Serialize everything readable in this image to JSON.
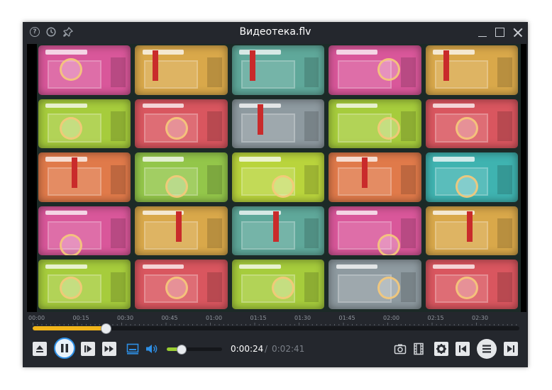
{
  "window": {
    "title": "Видеотека.flv"
  },
  "titlebar_icons": [
    "help-icon",
    "history-icon",
    "pin-icon"
  ],
  "timeline": {
    "labels": [
      "00:00",
      "00:15",
      "00:30",
      "00:45",
      "01:00",
      "01:15",
      "01:30",
      "01:45",
      "02:00",
      "02:15",
      "02:30"
    ],
    "progress": 0.15
  },
  "volume": {
    "level": 0.26
  },
  "time": {
    "current": "0:00:24",
    "separator": "/",
    "total": "0:02:41"
  },
  "colors": {
    "accent": "#2e8fe5",
    "progress": "#f2b51a",
    "volume": "#9acd32"
  },
  "mosaic_tiles": [
    {
      "color": "#d9579a",
      "r": 0,
      "c": 0,
      "variant": "lens"
    },
    {
      "color": "#d9a84a",
      "r": 0,
      "c": 1,
      "variant": "redbar"
    },
    {
      "color": "#5fa89a",
      "r": 0,
      "c": 2,
      "variant": "redbar"
    },
    {
      "color": "#d9579a",
      "r": 0,
      "c": 3,
      "variant": "lens"
    },
    {
      "color": "#d9a84a",
      "r": 0,
      "c": 4,
      "variant": "redbar"
    },
    {
      "color": "#a6cc3c",
      "r": 1,
      "c": 0,
      "variant": "lens"
    },
    {
      "color": "#d9565f",
      "r": 1,
      "c": 1,
      "variant": "lens"
    },
    {
      "color": "#8e9aa0",
      "r": 1,
      "c": 2,
      "variant": "redbar"
    },
    {
      "color": "#a6cc3c",
      "r": 1,
      "c": 3,
      "variant": "lens"
    },
    {
      "color": "#d9565f",
      "r": 1,
      "c": 4,
      "variant": "lens"
    },
    {
      "color": "#e07a4a",
      "r": 2,
      "c": 0,
      "variant": "redbar"
    },
    {
      "color": "#93c64a",
      "r": 2,
      "c": 1,
      "variant": "lens"
    },
    {
      "color": "#b9d43c",
      "r": 2,
      "c": 2,
      "variant": "lens"
    },
    {
      "color": "#e07a4a",
      "r": 2,
      "c": 3,
      "variant": "redbar"
    },
    {
      "color": "#3fb3b0",
      "r": 2,
      "c": 4,
      "variant": "lens"
    },
    {
      "color": "#d9579a",
      "r": 3,
      "c": 0,
      "variant": "lens"
    },
    {
      "color": "#d9a84a",
      "r": 3,
      "c": 1,
      "variant": "redbar"
    },
    {
      "color": "#5fa89a",
      "r": 3,
      "c": 2,
      "variant": "redbar"
    },
    {
      "color": "#d9579a",
      "r": 3,
      "c": 3,
      "variant": "lens"
    },
    {
      "color": "#d9a84a",
      "r": 3,
      "c": 4,
      "variant": "redbar"
    },
    {
      "color": "#a6cc3c",
      "r": 4,
      "c": 0,
      "variant": "lens"
    },
    {
      "color": "#d9565f",
      "r": 4,
      "c": 1,
      "variant": "lens"
    },
    {
      "color": "#a6cc3c",
      "r": 4,
      "c": 2,
      "variant": "lens"
    },
    {
      "color": "#8e9aa0",
      "r": 4,
      "c": 3,
      "variant": "lens"
    },
    {
      "color": "#d9565f",
      "r": 4,
      "c": 4,
      "variant": "lens"
    }
  ],
  "controls": {
    "left": [
      "eject-icon",
      "pause-icon",
      "step-forward-icon",
      "fast-forward-icon",
      "subtitles-icon",
      "volume-icon"
    ],
    "right": [
      "screenshot-icon",
      "film-icon",
      "settings-icon",
      "previous-icon",
      "playlist-menu-icon",
      "next-icon"
    ]
  }
}
